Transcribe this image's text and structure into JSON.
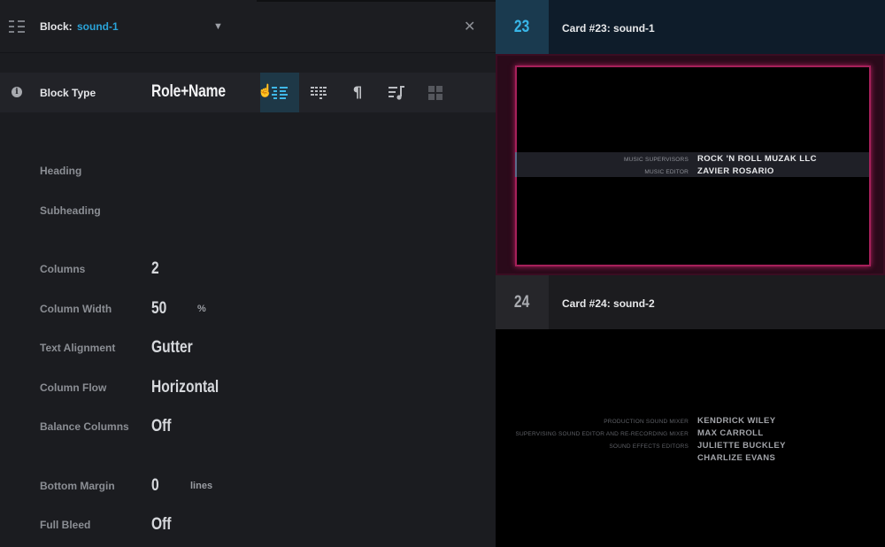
{
  "header": {
    "block_label": "Block:",
    "block_name": "sound-1"
  },
  "block_type": {
    "label": "Block Type",
    "value": "Role+Name",
    "tools": [
      {
        "icon": "role-name-layout-icon",
        "active": true
      },
      {
        "icon": "grid-dots-layout-icon",
        "active": false
      },
      {
        "icon": "paragraph-icon",
        "active": false
      },
      {
        "icon": "music-list-icon",
        "active": false
      },
      {
        "icon": "logo-grid-icon",
        "active": false
      }
    ]
  },
  "fields": {
    "heading": {
      "label": "Heading"
    },
    "subheading": {
      "label": "Subheading"
    },
    "columns": {
      "label": "Columns",
      "value": "2"
    },
    "column_width": {
      "label": "Column Width",
      "value": "50",
      "unit": "%"
    },
    "text_alignment": {
      "label": "Text Alignment",
      "value": "Gutter"
    },
    "column_flow": {
      "label": "Column Flow",
      "value": "Horizontal"
    },
    "balance_columns": {
      "label": "Balance Columns",
      "value": "Off"
    },
    "bottom_margin": {
      "label": "Bottom Margin",
      "value": "0",
      "unit": "lines"
    },
    "full_bleed": {
      "label": "Full Bleed",
      "value": "Off"
    }
  },
  "cards": [
    {
      "number": "23",
      "title": "Card #23:  sound-1",
      "selected": true,
      "credits": [
        {
          "role": "MUSIC SUPERVISORS",
          "name": "ROCK 'N ROLL MUZAK LLC"
        },
        {
          "role": "MUSIC EDITOR",
          "name": "ZAVIER ROSARIO"
        }
      ]
    },
    {
      "number": "24",
      "title": "Card #24:  sound-2",
      "selected": false,
      "credits": [
        {
          "role": "PRODUCTION SOUND MIXER",
          "name": "KENDRICK WILEY"
        },
        {
          "role": "SUPERVISING SOUND EDITOR AND RE-RECORDING MIXER",
          "name": "MAX CARROLL"
        },
        {
          "role": "SOUND EFFECTS EDITORS",
          "name": "JULIETTE BUCKLEY"
        },
        {
          "role": "",
          "name": "CHARLIZE EVANS"
        }
      ]
    }
  ],
  "colors": {
    "accent": "#2aa3d8",
    "selected_card_border": "#a5205a",
    "panel_bg": "#1b1c20"
  }
}
